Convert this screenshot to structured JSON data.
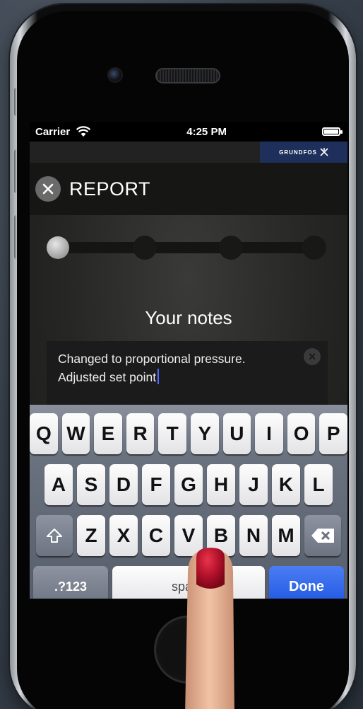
{
  "status_bar": {
    "carrier": "Carrier",
    "time": "4:25 PM"
  },
  "brand": {
    "name": "GRUNDFOS"
  },
  "header": {
    "title": "REPORT"
  },
  "progress": {
    "total_steps": 4,
    "current_step": 1
  },
  "notes": {
    "heading": "Your notes",
    "text": "Changed to proportional pressure.\nAdjusted set point"
  },
  "keyboard": {
    "row1": [
      "Q",
      "W",
      "E",
      "R",
      "T",
      "Y",
      "U",
      "I",
      "O",
      "P"
    ],
    "row2": [
      "A",
      "S",
      "D",
      "F",
      "G",
      "H",
      "J",
      "K",
      "L"
    ],
    "row3": [
      "Z",
      "X",
      "C",
      "V",
      "B",
      "N",
      "M"
    ],
    "numbers_label": ".?123",
    "space_label": "space",
    "done_label": "Done"
  }
}
